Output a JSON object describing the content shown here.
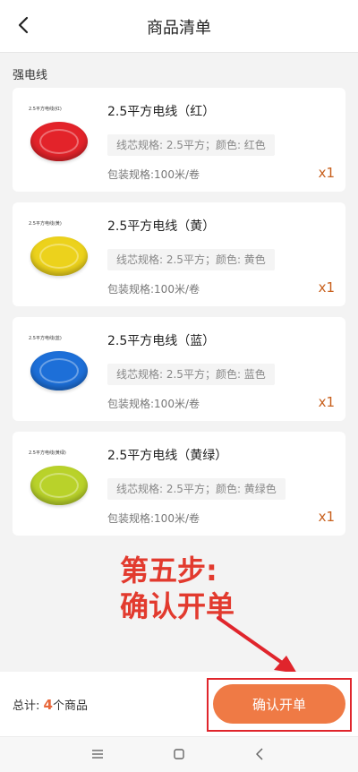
{
  "header": {
    "title": "商品清单",
    "back_icon": "chevron-left-icon"
  },
  "section": {
    "title": "强电线"
  },
  "products": [
    {
      "name": "2.5平方电线（红）",
      "thumb_label": "2.5平方电线(红)",
      "spec": "线芯规格: 2.5平方；颜色: 红色",
      "pack": "包装规格:100米/卷",
      "qty": "x1",
      "color": "#e3232a"
    },
    {
      "name": "2.5平方电线（黄）",
      "thumb_label": "2.5平方电线(黄)",
      "spec": "线芯规格: 2.5平方；颜色: 黄色",
      "pack": "包装规格:100米/卷",
      "qty": "x1",
      "color": "#ecd21c"
    },
    {
      "name": "2.5平方电线（蓝）",
      "thumb_label": "2.5平方电线(蓝)",
      "spec": "线芯规格: 2.5平方；颜色: 蓝色",
      "pack": "包装规格:100米/卷",
      "qty": "x1",
      "color": "#1d6fd8"
    },
    {
      "name": "2.5平方电线（黄绿）",
      "thumb_label": "2.5平方电线(黄绿)",
      "spec": "线芯规格: 2.5平方；颜色: 黄绿色",
      "pack": "包装规格:100米/卷",
      "qty": "x1",
      "color": "#b9d22a"
    }
  ],
  "annotation": {
    "line1": "第五步:",
    "line2": "确认开单",
    "color": "#e23a2e"
  },
  "footer": {
    "total_prefix": "总计: ",
    "total_count": "4",
    "total_suffix": "个商品",
    "confirm_label": "确认开单",
    "accent": "#ef7a45"
  },
  "navbar": {
    "menu_icon": "menu-icon",
    "home_icon": "home-square-icon",
    "back_icon": "back-triangle-icon"
  }
}
